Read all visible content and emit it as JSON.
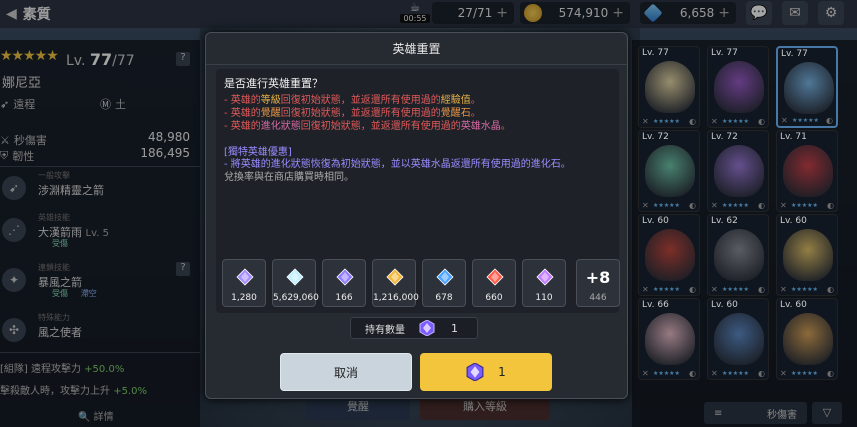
{
  "header": {
    "title": "素質",
    "timer": "00:55",
    "stamina": "27/71",
    "gold": "574,910",
    "gems": "6,658"
  },
  "hero": {
    "stars": "★★★★★",
    "level_prefix": "Lv.",
    "level": "77",
    "level_max": "/77",
    "name": "娜尼亞",
    "attack_type": "遠程",
    "element": "土",
    "stat1_label": "秒傷害",
    "stat1_value": "48,980",
    "stat2_label": "韌性",
    "stat2_value": "186,495",
    "skills": [
      {
        "category": "一般攻擊",
        "name": "涉淵精靈之箭",
        "sub": ""
      },
      {
        "category": "英雄技能",
        "name": "大漢箭雨",
        "level": "Lv. 5",
        "sub": "受傷"
      },
      {
        "category": "連鎖技能",
        "name": "暴風之箭",
        "sub": "受傷",
        "sub2": "滯空"
      },
      {
        "category": "特殊能力",
        "name": "風之使者",
        "sub": ""
      }
    ],
    "buff1_label": "[組隊] 遠程攻擊力",
    "buff1_value": "+50.0%",
    "buff2_label": "擊殺敵人時，攻擊力上升",
    "buff2_value": "+5.0%",
    "detail_label": "詳情"
  },
  "dialog": {
    "title": "英雄重置",
    "question": "是否進行英雄重置？",
    "lines": [
      {
        "pre": "- 英雄的",
        "hl": "等級",
        "mid": "回復初始狀態，並返還所有使用過的",
        "hl2": "經驗值",
        "post": "。"
      },
      {
        "pre": "- 英雄的",
        "hl": "覺醒",
        "mid": "回復初始狀態，並返還所有使用過的",
        "hl2": "覺醒石",
        "post": "。"
      },
      {
        "pre": "- 英雄的",
        "hl": "進化狀態",
        "mid": "回復初始狀態，並返還所有使用過的",
        "hl2": "英雄水晶",
        "post": "。"
      }
    ],
    "bonus_title": "[獨特英雄優惠]",
    "bonus_line": "- 將英雄的進化狀態恢復為初始狀態，並以英雄水晶返還所有使用過的進化石。",
    "note": "兌換率與在商店購買時相同。",
    "items": [
      {
        "name": "英雄水晶",
        "count": "1,280",
        "color": "#a58cff"
      },
      {
        "name": "經驗值",
        "count": "5,629,060",
        "color": "#bff0ff"
      },
      {
        "name": "進化石",
        "count": "166",
        "color": "#8f7bff"
      },
      {
        "name": "金幣",
        "count": "1,216,000",
        "color": "#f2b63a"
      },
      {
        "name": "覺醒石",
        "count": "678",
        "color": "#4aa3ff"
      },
      {
        "name": "紅色覺醒石",
        "count": "660",
        "color": "#ff5a4a"
      },
      {
        "name": "紫色覺醒石",
        "count": "110",
        "color": "#c27bff"
      }
    ],
    "more_label": "+8",
    "more_count": "446",
    "owned_label": "持有數量",
    "owned_value": "1",
    "cancel_label": "取消",
    "confirm_value": "1"
  },
  "roster": {
    "cards": [
      {
        "lv": "Lv. 77",
        "color": "#e8d9a8"
      },
      {
        "lv": "Lv. 77",
        "color": "#9a5cc9"
      },
      {
        "lv": "Lv. 77",
        "color": "#7bb7e8"
      },
      {
        "lv": "Lv. 72",
        "color": "#6fc6a9"
      },
      {
        "lv": "Lv. 72",
        "color": "#9a7ad8"
      },
      {
        "lv": "Lv. 71",
        "color": "#c8414a"
      },
      {
        "lv": "Lv. 60",
        "color": "#c0473e"
      },
      {
        "lv": "Lv. 62",
        "color": "#8b8e99"
      },
      {
        "lv": "Lv. 60",
        "color": "#e2c36a"
      },
      {
        "lv": "Lv. 66",
        "color": "#e9bcc8"
      },
      {
        "lv": "Lv. 60",
        "color": "#5d8bc7"
      },
      {
        "lv": "Lv. 60",
        "color": "#d7a35a"
      }
    ],
    "sort_label": "秒傷害",
    "under_left": "覺醒",
    "under_right": "購入等級"
  }
}
